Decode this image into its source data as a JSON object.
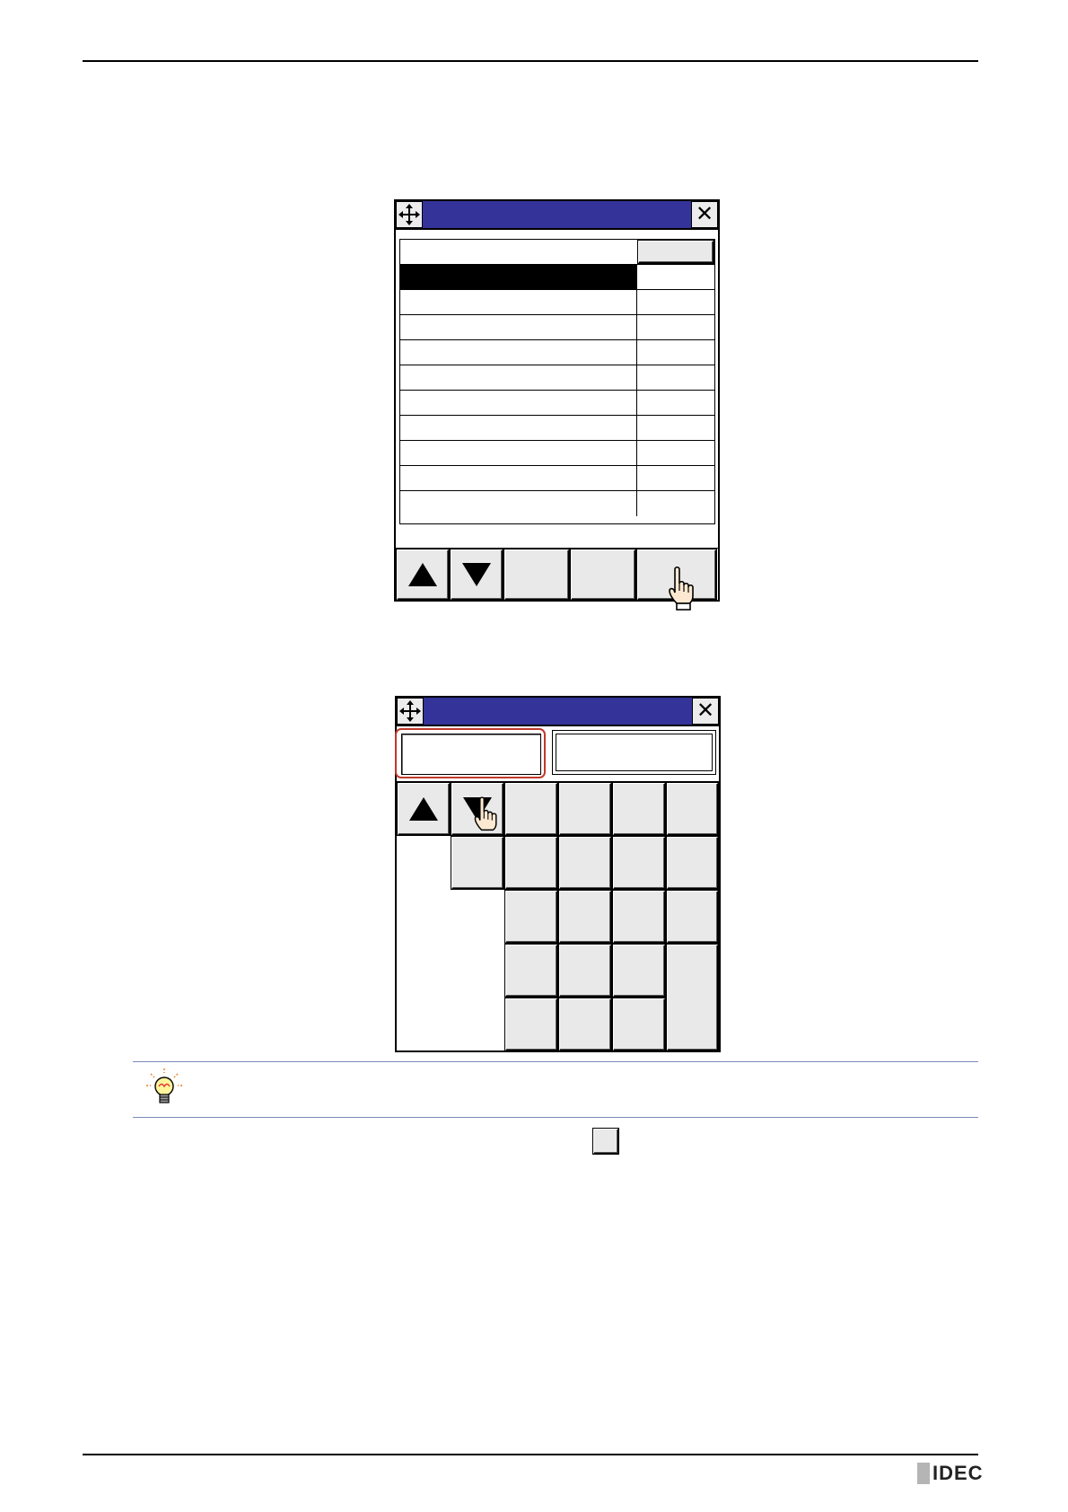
{
  "brand": {
    "logo_text": "IDEC"
  },
  "colors": {
    "titlebar": "#333399",
    "selection": "#000000",
    "highlight_border": "#c0392b",
    "tip_rule": "#7a8bb8"
  },
  "dialog1": {
    "move_icon": "move-icon",
    "close_label": "✕",
    "list_rows": 10,
    "selected_row": 1
  },
  "dialog2": {
    "move_icon": "move-icon",
    "close_label": "✕"
  },
  "tip": {
    "icon": "lightbulb-icon"
  }
}
